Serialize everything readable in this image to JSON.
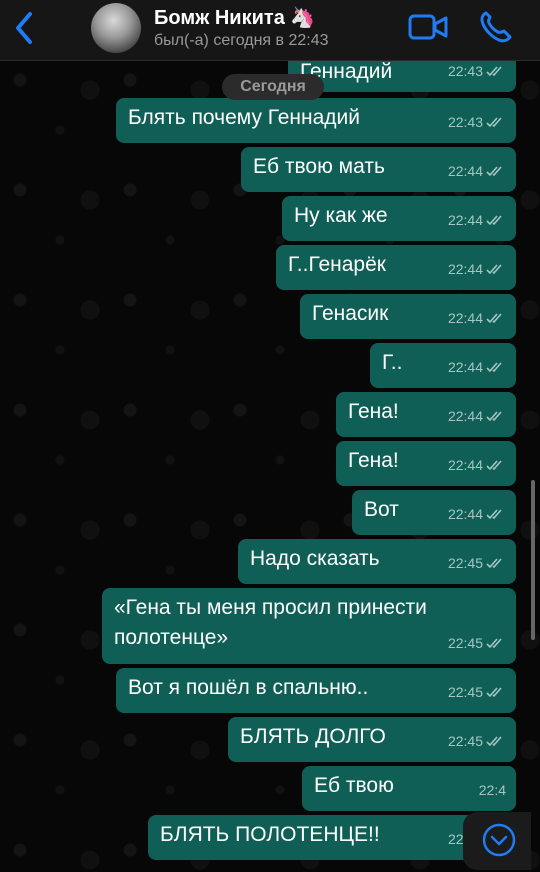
{
  "header": {
    "title": "Бомж Никита 🦄",
    "status": "был(-а) сегодня в 22:43"
  },
  "date_chip": "Сегодня",
  "colors": {
    "header_bg": "#161616",
    "chat_bg": "#070707",
    "bubble_out": "#0f5f56",
    "accent": "#1f7cf5"
  },
  "messages": [
    {
      "text": "Геннадий",
      "time": "22:43"
    },
    {
      "text": "Блять почему Геннадий",
      "time": "22:43"
    },
    {
      "text": "Еб твою мать",
      "time": "22:44"
    },
    {
      "text": "Ну как же",
      "time": "22:44"
    },
    {
      "text": "Г..Генарёк",
      "time": "22:44"
    },
    {
      "text": "Генасик",
      "time": "22:44"
    },
    {
      "text": "Г..",
      "time": "22:44"
    },
    {
      "text": "Гена!",
      "time": "22:44"
    },
    {
      "text": "Гена!",
      "time": "22:44"
    },
    {
      "text": "Вот",
      "time": "22:44"
    },
    {
      "text": "Надо сказать",
      "time": "22:45"
    },
    {
      "text": "«Гена ты меня просил принести полотенце»",
      "time": "22:45"
    },
    {
      "text": "Вот я пошёл в спальню..",
      "time": "22:45"
    },
    {
      "text": "БЛЯТЬ ДОЛГО",
      "time": "22:45"
    },
    {
      "text": "Еб твою",
      "time": "22:4"
    },
    {
      "text": "БЛЯТЬ ПОЛОТЕНЦЕ!!",
      "time": "22:46"
    }
  ],
  "icons": {
    "back": "chevron-left-icon",
    "video": "video-camera-icon",
    "call": "phone-icon",
    "read": "double-check-icon",
    "scroll_down": "chevron-down-circle-icon"
  }
}
